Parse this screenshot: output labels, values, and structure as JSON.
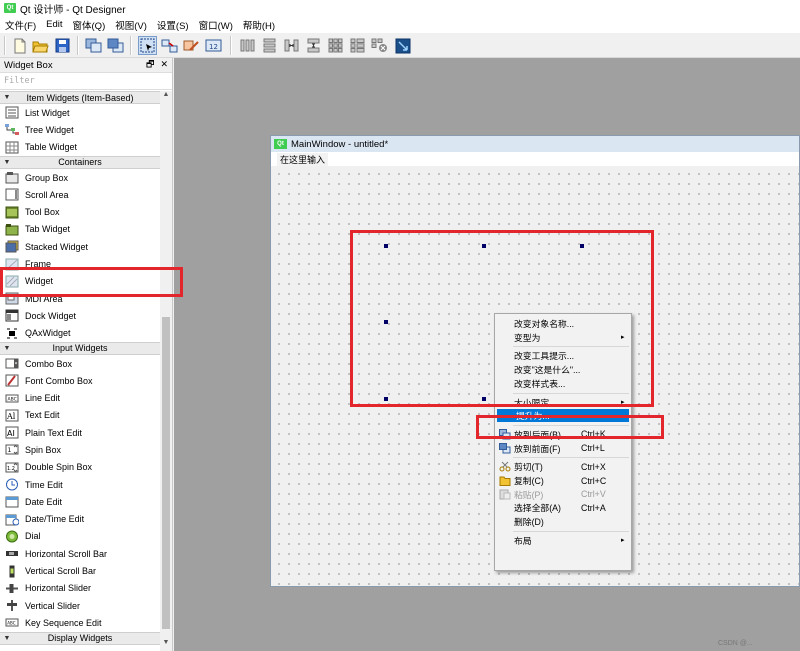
{
  "window": {
    "title": "Qt 设计师 - Qt Designer"
  },
  "menubar": [
    {
      "label": "文件(F)"
    },
    {
      "label": "Edit"
    },
    {
      "label": "窗体(Q)"
    },
    {
      "label": "视图(V)"
    },
    {
      "label": "设置(S)"
    },
    {
      "label": "窗口(W)"
    },
    {
      "label": "帮助(H)"
    }
  ],
  "toolbar": {
    "buttons": [
      "new-icon",
      "open-icon",
      "save-icon",
      "send-to-back-icon",
      "bring-to-front-icon",
      "edit-widgets-icon",
      "edit-signals-slots-icon",
      "edit-buddies-icon",
      "edit-tab-order-icon",
      "layout-horizontal-icon",
      "layout-vertical-icon",
      "layout-horizontal-splitter-icon",
      "layout-vertical-splitter-icon",
      "layout-grid-icon",
      "layout-form-icon",
      "break-layout-icon",
      "adjust-size-icon"
    ]
  },
  "widget_box": {
    "title": "Widget Box",
    "filter_placeholder": "Filter",
    "sections": [
      {
        "label": "Item Widgets (Item-Based)",
        "items": [
          {
            "label": "List Widget",
            "icon": "list-widget-icon"
          },
          {
            "label": "Tree Widget",
            "icon": "tree-widget-icon"
          },
          {
            "label": "Table Widget",
            "icon": "table-widget-icon"
          }
        ]
      },
      {
        "label": "Containers",
        "items": [
          {
            "label": "Group Box",
            "icon": "group-box-icon"
          },
          {
            "label": "Scroll Area",
            "icon": "scroll-area-icon"
          },
          {
            "label": "Tool Box",
            "icon": "tool-box-icon"
          },
          {
            "label": "Tab Widget",
            "icon": "tab-widget-icon"
          },
          {
            "label": "Stacked Widget",
            "icon": "stacked-widget-icon"
          },
          {
            "label": "Frame",
            "icon": "frame-icon"
          },
          {
            "label": "Widget",
            "icon": "widget-icon"
          },
          {
            "label": "MDI Area",
            "icon": "mdi-area-icon"
          },
          {
            "label": "Dock Widget",
            "icon": "dock-widget-icon"
          },
          {
            "label": "QAxWidget",
            "icon": "qaxwidget-icon"
          }
        ]
      },
      {
        "label": "Input Widgets",
        "items": [
          {
            "label": "Combo Box",
            "icon": "combo-box-icon"
          },
          {
            "label": "Font Combo Box",
            "icon": "font-combo-box-icon"
          },
          {
            "label": "Line Edit",
            "icon": "line-edit-icon"
          },
          {
            "label": "Text Edit",
            "icon": "text-edit-icon"
          },
          {
            "label": "Plain Text Edit",
            "icon": "plain-text-edit-icon"
          },
          {
            "label": "Spin Box",
            "icon": "spin-box-icon"
          },
          {
            "label": "Double Spin Box",
            "icon": "double-spin-box-icon"
          },
          {
            "label": "Time Edit",
            "icon": "time-edit-icon"
          },
          {
            "label": "Date Edit",
            "icon": "date-edit-icon"
          },
          {
            "label": "Date/Time Edit",
            "icon": "date-time-edit-icon"
          },
          {
            "label": "Dial",
            "icon": "dial-icon"
          },
          {
            "label": "Horizontal Scroll Bar",
            "icon": "horizontal-scroll-bar-icon"
          },
          {
            "label": "Vertical Scroll Bar",
            "icon": "vertical-scroll-bar-icon"
          },
          {
            "label": "Horizontal Slider",
            "icon": "horizontal-slider-icon"
          },
          {
            "label": "Vertical Slider",
            "icon": "vertical-slider-icon"
          },
          {
            "label": "Key Sequence Edit",
            "icon": "key-sequence-edit-icon"
          }
        ]
      },
      {
        "label": "Display Widgets",
        "items": []
      }
    ]
  },
  "main_window": {
    "title": "MainWindow - untitled*",
    "menu_placeholder": "在这里输入"
  },
  "context_menu": {
    "items": [
      {
        "label": "改变对象名称...",
        "shortcut": "",
        "submenu": false,
        "disabled": false,
        "icon": ""
      },
      {
        "label": "变型为",
        "shortcut": "",
        "submenu": true,
        "disabled": false,
        "icon": ""
      },
      {
        "sep": true
      },
      {
        "label": "改变工具提示...",
        "shortcut": "",
        "submenu": false,
        "disabled": false,
        "icon": ""
      },
      {
        "label": "改变\"这是什么\"...",
        "shortcut": "",
        "submenu": false,
        "disabled": false,
        "icon": ""
      },
      {
        "label": "改变样式表...",
        "shortcut": "",
        "submenu": false,
        "disabled": false,
        "icon": ""
      },
      {
        "sep": true
      },
      {
        "label": "大小限定",
        "shortcut": "",
        "submenu": true,
        "disabled": false,
        "icon": ""
      },
      {
        "label": "提升为...",
        "shortcut": "",
        "submenu": false,
        "disabled": false,
        "highlighted": true,
        "icon": ""
      },
      {
        "sep": true
      },
      {
        "label": "放到后面(B)",
        "shortcut": "Ctrl+K",
        "submenu": false,
        "disabled": false,
        "icon": "send-to-back-icon"
      },
      {
        "label": "放到前面(F)",
        "shortcut": "Ctrl+L",
        "submenu": false,
        "disabled": false,
        "icon": "bring-to-front-icon"
      },
      {
        "sep": true
      },
      {
        "label": "剪切(T)",
        "shortcut": "Ctrl+X",
        "submenu": false,
        "disabled": false,
        "icon": "cut-icon"
      },
      {
        "label": "复制(C)",
        "shortcut": "Ctrl+C",
        "submenu": false,
        "disabled": false,
        "icon": "copy-icon"
      },
      {
        "label": "粘贴(P)",
        "shortcut": "Ctrl+V",
        "submenu": false,
        "disabled": true,
        "icon": "paste-icon"
      },
      {
        "label": "选择全部(A)",
        "shortcut": "Ctrl+A",
        "submenu": false,
        "disabled": false,
        "icon": ""
      },
      {
        "label": "删除(D)",
        "shortcut": "",
        "submenu": false,
        "disabled": false,
        "icon": ""
      },
      {
        "sep": true
      },
      {
        "label": "布局",
        "shortcut": "",
        "submenu": true,
        "disabled": false,
        "icon": ""
      }
    ]
  },
  "watermark": "CSDN @..."
}
